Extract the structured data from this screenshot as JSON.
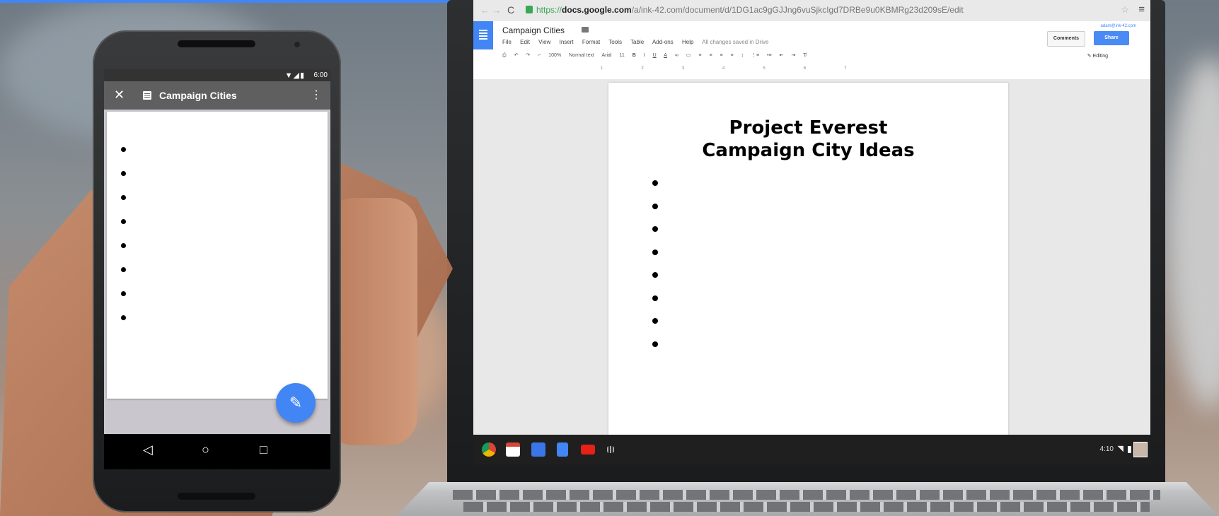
{
  "browser": {
    "url_proto": "https://",
    "url_host": "docs.google.com",
    "url_path": "/a/ink-42.com/document/d/1DG1ac9gGJJng6vuSjkcIgd7DRBe9u0KBMRg23d209sE/edit"
  },
  "docs": {
    "title": "Campaign Cities",
    "menu": [
      "File",
      "Edit",
      "View",
      "Insert",
      "Format",
      "Tools",
      "Table",
      "Add-ons",
      "Help"
    ],
    "saved_status": "All changes saved in Drive",
    "account": "adam@ink-42.com",
    "comments_label": "Comments",
    "share_label": "Share",
    "toolbar": {
      "zoom": "100%",
      "style": "Normal text",
      "font": "Arial",
      "size": "11"
    },
    "editing_mode": "Editing",
    "ruler_numbers": [
      "1",
      "2",
      "3",
      "4",
      "5",
      "6",
      "7"
    ],
    "heading_line1": "Project Everest",
    "heading_line2": "Campaign City Ideas",
    "bullet_count": 8
  },
  "shelf": {
    "time": "4:10",
    "apps": [
      "chrome-icon",
      "gmail-icon",
      "google-plus-icon",
      "docs-icon",
      "youtube-icon",
      "app-launcher-icon"
    ]
  },
  "phone": {
    "status_time": "6:00",
    "app_title": "Campaign Cities",
    "bullet_count": 8,
    "colors": {
      "fab": "#4285f4",
      "app_bar": "#5f5f5f"
    }
  }
}
